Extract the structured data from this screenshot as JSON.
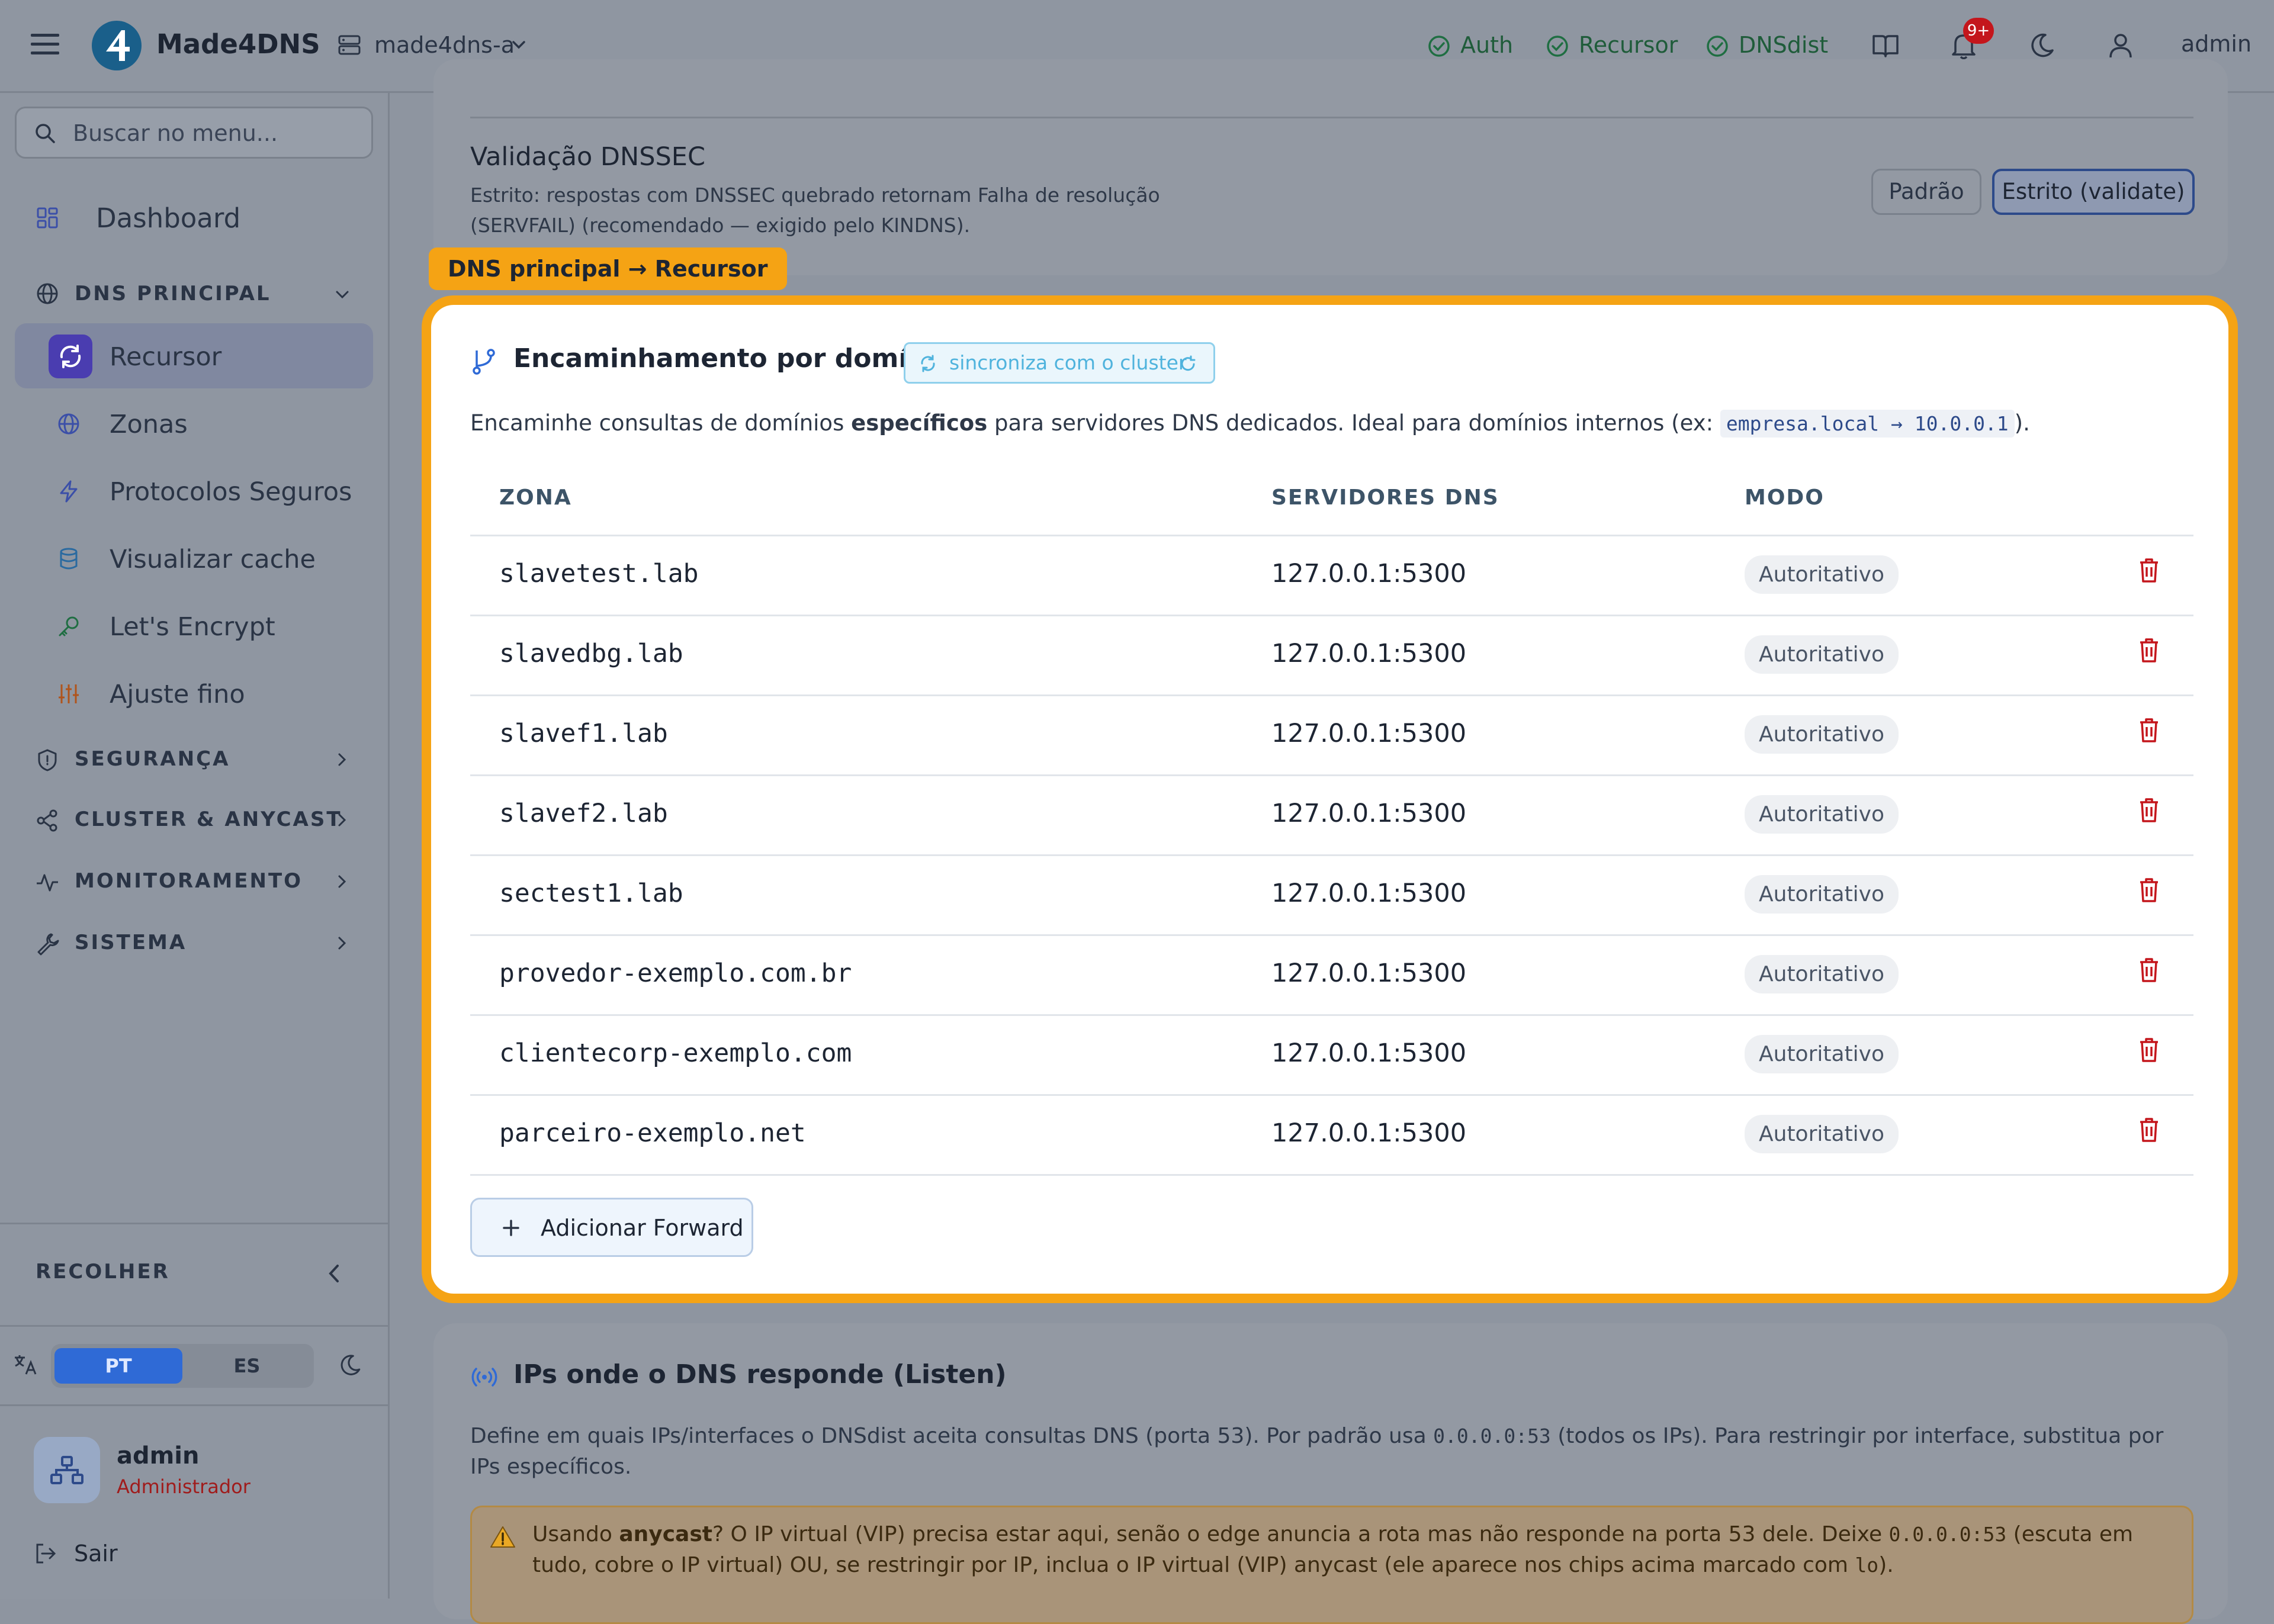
{
  "topbar": {
    "app_name": "Made4DNS",
    "server_selector": "made4dns-a",
    "status": [
      {
        "label": "Auth",
        "color": "#1f6e42"
      },
      {
        "label": "Recursor",
        "color": "#1f6e42"
      },
      {
        "label": "DNSdist",
        "color": "#1f6e42"
      }
    ],
    "notification_badge": "9+",
    "user_label": "admin"
  },
  "sidebar": {
    "search_placeholder": "Buscar no menu...",
    "dashboard": "Dashboard",
    "sections": {
      "dns_principal": "DNS PRINCIPAL",
      "seguranca": "SEGURANÇA",
      "cluster": "CLUSTER & ANYCAST",
      "monitoramento": "MONITORAMENTO",
      "sistema": "SISTEMA"
    },
    "items": [
      {
        "label": "Recursor",
        "icon": "refresh-icon"
      },
      {
        "label": "Zonas",
        "icon": "globe-icon"
      },
      {
        "label": "Protocolos Seguros",
        "icon": "bolt-icon"
      },
      {
        "label": "Visualizar cache",
        "icon": "database-icon"
      },
      {
        "label": "Let's Encrypt",
        "icon": "key-icon"
      },
      {
        "label": "Ajuste fino",
        "icon": "sliders-icon"
      }
    ],
    "collapse_label": "RECOLHER",
    "lang": {
      "pt": "PT",
      "es": "ES"
    },
    "user": {
      "name": "admin",
      "role": "Administrador"
    },
    "logout": "Sair"
  },
  "dnssec": {
    "title": "Validação DNSSEC",
    "description": "Estrito: respostas com DNSSEC quebrado retornam Falha de resolução (SERVFAIL) (recomendado — exigido pelo KINDNS).",
    "btn_default": "Padrão",
    "btn_strict": "Estrito (validate)"
  },
  "highlight_tag": "DNS principal → Recursor",
  "forwarding": {
    "title": "Encaminhamento por domínio",
    "sync_label": "sincroniza com o cluster",
    "desc_before": "Encaminhe consultas de domínios ",
    "desc_bold": "específicos",
    "desc_after": " para servidores DNS dedicados. Ideal para domínios internos (ex: ",
    "desc_code": "empresa.local → 10.0.0.1",
    "desc_end": ").",
    "columns": {
      "zone": "ZONA",
      "servers": "SERVIDORES DNS",
      "mode": "MODO"
    },
    "rows": [
      {
        "zone": "slavetest.lab",
        "servers": "127.0.0.1:5300",
        "mode": "Autoritativo"
      },
      {
        "zone": "slavedbg.lab",
        "servers": "127.0.0.1:5300",
        "mode": "Autoritativo"
      },
      {
        "zone": "slavef1.lab",
        "servers": "127.0.0.1:5300",
        "mode": "Autoritativo"
      },
      {
        "zone": "slavef2.lab",
        "servers": "127.0.0.1:5300",
        "mode": "Autoritativo"
      },
      {
        "zone": "sectest1.lab",
        "servers": "127.0.0.1:5300",
        "mode": "Autoritativo"
      },
      {
        "zone": "provedor-exemplo.com.br",
        "servers": "127.0.0.1:5300",
        "mode": "Autoritativo"
      },
      {
        "zone": "clientecorp-exemplo.com",
        "servers": "127.0.0.1:5300",
        "mode": "Autoritativo"
      },
      {
        "zone": "parceiro-exemplo.net",
        "servers": "127.0.0.1:5300",
        "mode": "Autoritativo"
      }
    ],
    "add_button": "Adicionar Forward"
  },
  "listen": {
    "title": "IPs onde o DNS responde (Listen)",
    "desc_1": "Define em quais IPs/interfaces o DNSdist aceita consultas DNS (porta 53). Por padrão usa ",
    "desc_code": "0.0.0.0:53",
    "desc_2": " (todos os IPs). Para restringir por interface, substitua por IPs específicos.",
    "warn_1": "Usando ",
    "warn_bold": "anycast",
    "warn_2": "? O IP virtual (VIP) precisa estar aqui, senão o edge anuncia a rota mas não responde na porta 53 dele. Deixe ",
    "warn_code": "0.0.0.0:53",
    "warn_3": " (escuta em tudo, cobre o IP virtual) OU, se restringir por IP, inclua o IP virtual (VIP) anycast (ele aparece nos chips acima marcado com ",
    "warn_code2": "lo",
    "warn_4": ")."
  }
}
